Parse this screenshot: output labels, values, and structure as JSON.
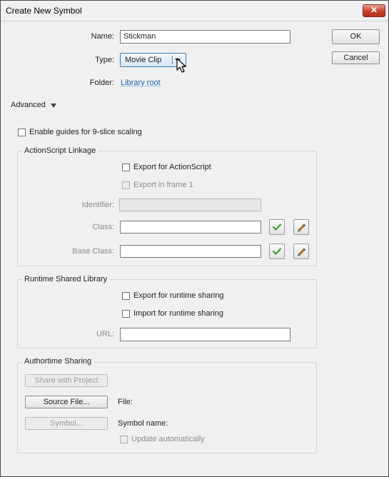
{
  "window": {
    "title": "Create New Symbol",
    "close_glyph": "✕"
  },
  "form": {
    "name_label": "Name:",
    "name_value": "Stickman",
    "type_label": "Type:",
    "type_value": "Movie Clip",
    "folder_label": "Folder:",
    "folder_value": "Library root"
  },
  "buttons": {
    "ok": "OK",
    "cancel": "Cancel"
  },
  "advanced": {
    "toggle_label": "Advanced",
    "nine_slice_label": "Enable guides for 9-slice scaling",
    "nine_slice_checked": false
  },
  "actionscript": {
    "title": "ActionScript Linkage",
    "export_as_label": "Export for ActionScript",
    "export_as_checked": false,
    "export_frame1_label": "Export in frame 1",
    "export_frame1_checked": false,
    "identifier_label": "Identifier:",
    "identifier_value": "",
    "class_label": "Class:",
    "class_value": "",
    "base_class_label": "Base Class:",
    "base_class_value": ""
  },
  "runtime": {
    "title": "Runtime Shared Library",
    "export_label": "Export for runtime sharing",
    "export_checked": false,
    "import_label": "Import for runtime sharing",
    "import_checked": false,
    "url_label": "URL:",
    "url_value": ""
  },
  "authortime": {
    "title": "Authortime Sharing",
    "share_button": "Share with Project",
    "source_button": "Source File...",
    "file_label": "File:",
    "symbol_button": "Symbol...",
    "symbol_name_label": "Symbol name:",
    "update_label": "Update automatically",
    "update_checked": false
  },
  "icons": {
    "validate": "check-icon",
    "edit": "pencil-icon",
    "cursor": "mouse-cursor"
  },
  "colors": {
    "link": "#1e64b4",
    "close_button": "#c4402c",
    "dropdown_border": "#3c7fb1",
    "check_green": "#3aa02a"
  }
}
